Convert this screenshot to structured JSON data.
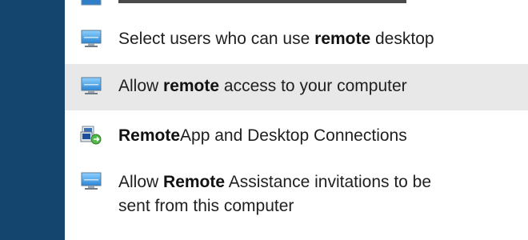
{
  "results": [
    {
      "id": "select-users",
      "icon": "remote-settings-icon",
      "parts": [
        {
          "text": "Select users who can use ",
          "bold": false
        },
        {
          "text": "remote",
          "bold": true
        },
        {
          "text": " desktop",
          "bold": false
        }
      ],
      "highlighted": false
    },
    {
      "id": "allow-remote-access",
      "icon": "remote-settings-icon",
      "parts": [
        {
          "text": "Allow ",
          "bold": false
        },
        {
          "text": "remote",
          "bold": true
        },
        {
          "text": " access to your computer",
          "bold": false
        }
      ],
      "highlighted": true
    },
    {
      "id": "remoteapp",
      "icon": "remoteapp-connections-icon",
      "parts": [
        {
          "text": "Remote",
          "bold": true
        },
        {
          "text": "App and Desktop Connections",
          "bold": false
        }
      ],
      "highlighted": false
    },
    {
      "id": "remote-assistance",
      "icon": "remote-settings-icon",
      "line1": [
        {
          "text": "Allow ",
          "bold": false
        },
        {
          "text": "Remote",
          "bold": true
        },
        {
          "text": " Assistance invitations to be",
          "bold": false
        }
      ],
      "line2": [
        {
          "text": "sent from this computer",
          "bold": false
        }
      ],
      "highlighted": false
    }
  ],
  "colors": {
    "left_panel": "#13456f",
    "highlight": "#e8e8e8",
    "text": "#1f1f1f"
  }
}
